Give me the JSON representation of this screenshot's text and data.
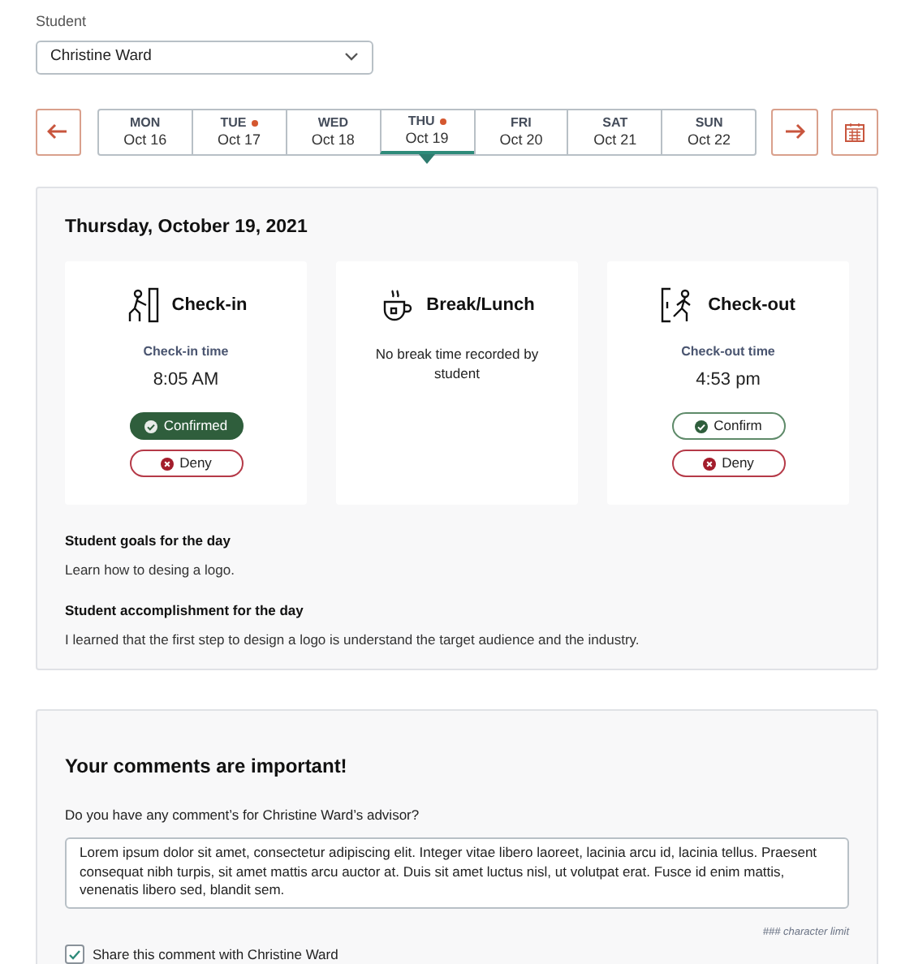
{
  "student": {
    "label": "Student",
    "value": "Christine Ward"
  },
  "days": [
    {
      "dow": "MON",
      "date": "Oct 16",
      "selected": false,
      "flagged": false
    },
    {
      "dow": "TUE",
      "date": "Oct 17",
      "selected": false,
      "flagged": true
    },
    {
      "dow": "WED",
      "date": "Oct 18",
      "selected": false,
      "flagged": false
    },
    {
      "dow": "THU",
      "date": "Oct 19",
      "selected": true,
      "flagged": true
    },
    {
      "dow": "FRI",
      "date": "Oct 20",
      "selected": false,
      "flagged": false
    },
    {
      "dow": "SAT",
      "date": "Oct 21",
      "selected": false,
      "flagged": false
    },
    {
      "dow": "SUN",
      "date": "Oct 22",
      "selected": false,
      "flagged": false
    }
  ],
  "day_panel": {
    "title": "Thursday, October 19, 2021",
    "cards": [
      {
        "kind": "checkin",
        "title": "Check-in",
        "time_label": "Check-in time",
        "time": "8:05 AM",
        "actions": [
          {
            "kind": "confirm",
            "label": "Confirmed",
            "selected": true
          },
          {
            "kind": "deny",
            "label": "Deny",
            "selected": false
          }
        ]
      },
      {
        "kind": "break",
        "title": "Break/Lunch",
        "note": "No break time recorded by student"
      },
      {
        "kind": "checkout",
        "title": "Check-out",
        "time_label": "Check-out time",
        "time": "4:53 pm",
        "actions": [
          {
            "kind": "confirm",
            "label": "Confirm",
            "selected": false
          },
          {
            "kind": "deny",
            "label": "Deny",
            "selected": false
          }
        ]
      }
    ],
    "sections": [
      {
        "heading": "Student goals for the day",
        "text": "Learn how to desing a logo."
      },
      {
        "heading": "Student accomplishment for the day",
        "text": "I learned that the first step to design a logo is understand the target audience and the industry."
      }
    ]
  },
  "comments": {
    "title": "Your comments are important!",
    "question": "Do you have any comment’s for Christine Ward’s advisor?",
    "value": "Lorem ipsum dolor sit amet, consectetur adipiscing elit. Integer vitae libero laoreet, lacinia arcu id, lacinia tellus. Praesent consequat nibh turpis, sit amet mattis arcu auctor at. Duis sit amet luctus nisl, ut volutpat erat. Fusce id enim mattis, venenatis libero sed, blandit sem.",
    "limit": "### character limit",
    "share": {
      "label": "Share this comment with Christine Ward",
      "checked": true
    }
  }
}
